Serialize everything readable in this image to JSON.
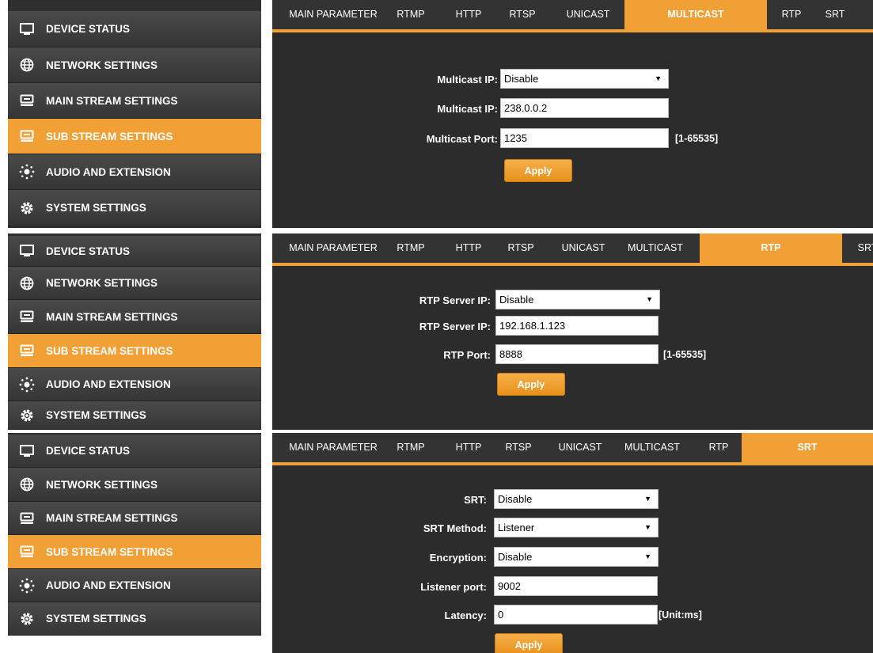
{
  "colors": {
    "accent": "#f0a035",
    "background": "#2c2c2c",
    "sidebar": "#3f3f3f"
  },
  "sidebar": {
    "items": [
      {
        "label": "DEVICE STATUS",
        "icon": "monitor-icon"
      },
      {
        "label": "NETWORK SETTINGS",
        "icon": "globe-icon"
      },
      {
        "label": "MAIN STREAM SETTINGS",
        "icon": "stream-icon"
      },
      {
        "label": "SUB STREAM SETTINGS",
        "icon": "stream-icon",
        "active": true
      },
      {
        "label": "AUDIO AND EXTENSION",
        "icon": "audio-icon"
      },
      {
        "label": "SYSTEM SETTINGS",
        "icon": "gear-icon"
      }
    ]
  },
  "tabs": [
    "MAIN PARAMETER",
    "RTMP",
    "HTTP",
    "RTSP",
    "UNICAST",
    "MULTICAST",
    "RTP",
    "SRT"
  ],
  "panels": {
    "multicast": {
      "active_tab": "MULTICAST",
      "mode_label": "Multicast IP:",
      "mode_value": "Disable",
      "ip_label": "Multicast IP:",
      "ip_value": "238.0.0.2",
      "port_label": "Multicast Port:",
      "port_value": "1235",
      "port_range": "[1-65535]",
      "apply": "Apply"
    },
    "rtp": {
      "active_tab": "RTP",
      "mode_label": "RTP Server IP:",
      "mode_value": "Disable",
      "ip_label": "RTP Server IP:",
      "ip_value": "192.168.1.123",
      "port_label": "RTP Port:",
      "port_value": "8888",
      "port_range": "[1-65535]",
      "apply": "Apply"
    },
    "srt": {
      "active_tab": "SRT",
      "srt_label": "SRT:",
      "srt_value": "Disable",
      "method_label": "SRT Method:",
      "method_value": "Listener",
      "encryption_label": "Encryption:",
      "encryption_value": "Disable",
      "listener_port_label": "Listener port:",
      "listener_port_value": "9002",
      "latency_label": "Latency:",
      "latency_value": "0",
      "latency_unit": "[Unit:ms]",
      "apply": "Apply"
    }
  }
}
